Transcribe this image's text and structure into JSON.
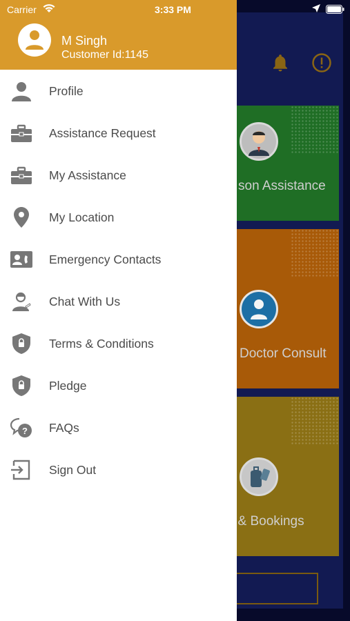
{
  "status_bar": {
    "carrier": "Carrier",
    "time": "3:33 PM"
  },
  "drawer": {
    "header_color": "#d99a2b",
    "user": {
      "name": "M Singh",
      "customer_id": "Customer Id:1145"
    },
    "items": [
      {
        "label": "Profile",
        "icon": "person-icon"
      },
      {
        "label": "Assistance Request",
        "icon": "briefcase-icon"
      },
      {
        "label": "My Assistance",
        "icon": "briefcase-icon"
      },
      {
        "label": "My Location",
        "icon": "location-pin-icon"
      },
      {
        "label": "Emergency Contacts",
        "icon": "contact-card-icon"
      },
      {
        "label": "Chat With Us",
        "icon": "support-agent-icon"
      },
      {
        "label": "Terms & Conditions",
        "icon": "shield-lock-icon"
      },
      {
        "label": "Pledge",
        "icon": "shield-lock-icon"
      },
      {
        "label": "FAQs",
        "icon": "chat-question-icon"
      },
      {
        "label": "Sign Out",
        "icon": "sign-out-icon"
      }
    ]
  },
  "background": {
    "tiles": [
      {
        "label": "son Assistance",
        "color": "#1f6e25"
      },
      {
        "label": "Doctor Consult",
        "color": "#a85a08"
      },
      {
        "label": "l & Bookings",
        "color": "#8a6f14"
      }
    ]
  }
}
